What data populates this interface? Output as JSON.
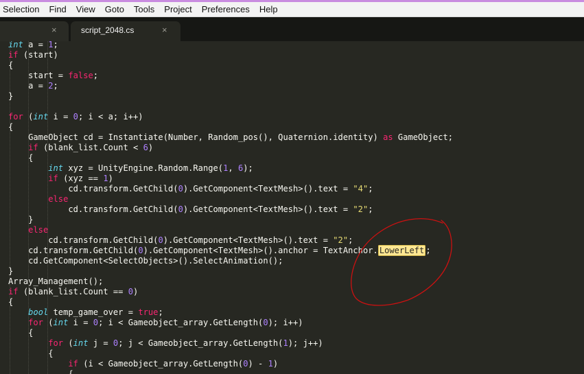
{
  "menu": [
    "Selection",
    "Find",
    "View",
    "Goto",
    "Tools",
    "Project",
    "Preferences",
    "Help"
  ],
  "tabs": [
    {
      "label": "",
      "close": "×"
    },
    {
      "label": "script_2048.cs",
      "close": "×"
    }
  ],
  "colors": {
    "keyword": "#f92672",
    "type": "#66d9ef",
    "number": "#ae81ff",
    "string": "#e6db74",
    "text": "#f8f8f2",
    "background": "#272822",
    "highlight": "#ffe792",
    "annotation": "#cc1111"
  },
  "code_lines": [
    [
      [
        "type",
        "int"
      ],
      [
        "t",
        " a = "
      ],
      [
        "num",
        "1"
      ],
      [
        "t",
        ";"
      ]
    ],
    [
      [
        "kw",
        "if"
      ],
      [
        "t",
        " (start)"
      ]
    ],
    [
      [
        "t",
        "{"
      ]
    ],
    [
      [
        "t",
        "    start = "
      ],
      [
        "kw",
        "false"
      ],
      [
        "t",
        ";"
      ]
    ],
    [
      [
        "t",
        "    a = "
      ],
      [
        "num",
        "2"
      ],
      [
        "t",
        ";"
      ]
    ],
    [
      [
        "t",
        "}"
      ]
    ],
    [],
    [
      [
        "kw",
        "for"
      ],
      [
        "t",
        " ("
      ],
      [
        "type",
        "int"
      ],
      [
        "t",
        " i = "
      ],
      [
        "num",
        "0"
      ],
      [
        "t",
        "; i < a; i++)"
      ]
    ],
    [
      [
        "t",
        "{"
      ]
    ],
    [
      [
        "t",
        "    GameObject cd = Instantiate(Number, Random_pos(), Quaternion.identity) "
      ],
      [
        "kw",
        "as"
      ],
      [
        "t",
        " GameObject;"
      ]
    ],
    [
      [
        "t",
        "    "
      ],
      [
        "kw",
        "if"
      ],
      [
        "t",
        " (blank_list.Count < "
      ],
      [
        "num",
        "6"
      ],
      [
        "t",
        ")"
      ]
    ],
    [
      [
        "t",
        "    {"
      ]
    ],
    [
      [
        "t",
        "        "
      ],
      [
        "type",
        "int"
      ],
      [
        "t",
        " xyz = UnityEngine.Random.Range("
      ],
      [
        "num",
        "1"
      ],
      [
        "t",
        ", "
      ],
      [
        "num",
        "6"
      ],
      [
        "t",
        ");"
      ]
    ],
    [
      [
        "t",
        "        "
      ],
      [
        "kw",
        "if"
      ],
      [
        "t",
        " (xyz == "
      ],
      [
        "num",
        "1"
      ],
      [
        "t",
        ")"
      ]
    ],
    [
      [
        "t",
        "            cd.transform.GetChild("
      ],
      [
        "num",
        "0"
      ],
      [
        "t",
        ").GetComponent<TextMesh>().text = "
      ],
      [
        "str",
        "\"4\""
      ],
      [
        "t",
        ";"
      ]
    ],
    [
      [
        "t",
        "        "
      ],
      [
        "kw",
        "else"
      ]
    ],
    [
      [
        "t",
        "            cd.transform.GetChild("
      ],
      [
        "num",
        "0"
      ],
      [
        "t",
        ").GetComponent<TextMesh>().text = "
      ],
      [
        "str",
        "\"2\""
      ],
      [
        "t",
        ";"
      ]
    ],
    [
      [
        "t",
        "    }"
      ]
    ],
    [
      [
        "t",
        "    "
      ],
      [
        "kw",
        "else"
      ]
    ],
    [
      [
        "t",
        "        cd.transform.GetChild("
      ],
      [
        "num",
        "0"
      ],
      [
        "t",
        ").GetComponent<TextMesh>().text = "
      ],
      [
        "str",
        "\"2\""
      ],
      [
        "t",
        ";"
      ]
    ],
    [
      [
        "t",
        "    cd.transform.GetChild("
      ],
      [
        "num",
        "0"
      ],
      [
        "t",
        ").GetComponent<TextMesh>().anchor = TextAnchor."
      ],
      [
        "hl",
        "LowerLeft"
      ],
      [
        "t",
        ";"
      ]
    ],
    [
      [
        "t",
        "    cd.GetComponent<SelectObjects>().SelectAnimation();"
      ]
    ],
    [
      [
        "t",
        "}"
      ]
    ],
    [
      [
        "t",
        "Array_Management();"
      ]
    ],
    [
      [
        "kw",
        "if"
      ],
      [
        "t",
        " (blank_list.Count == "
      ],
      [
        "num",
        "0"
      ],
      [
        "t",
        ")"
      ]
    ],
    [
      [
        "t",
        "{"
      ]
    ],
    [
      [
        "t",
        "    "
      ],
      [
        "type",
        "bool"
      ],
      [
        "t",
        " temp_game_over = "
      ],
      [
        "kw",
        "true"
      ],
      [
        "t",
        ";"
      ]
    ],
    [
      [
        "t",
        "    "
      ],
      [
        "kw",
        "for"
      ],
      [
        "t",
        " ("
      ],
      [
        "type",
        "int"
      ],
      [
        "t",
        " i = "
      ],
      [
        "num",
        "0"
      ],
      [
        "t",
        "; i < Gameobject_array.GetLength("
      ],
      [
        "num",
        "0"
      ],
      [
        "t",
        "); i++)"
      ]
    ],
    [
      [
        "t",
        "    {"
      ]
    ],
    [
      [
        "t",
        "        "
      ],
      [
        "kw",
        "for"
      ],
      [
        "t",
        " ("
      ],
      [
        "type",
        "int"
      ],
      [
        "t",
        " j = "
      ],
      [
        "num",
        "0"
      ],
      [
        "t",
        "; j < Gameobject_array.GetLength("
      ],
      [
        "num",
        "1"
      ],
      [
        "t",
        "); j++)"
      ]
    ],
    [
      [
        "t",
        "        {"
      ]
    ],
    [
      [
        "t",
        "            "
      ],
      [
        "kw",
        "if"
      ],
      [
        "t",
        " (i < Gameobject_array.GetLength("
      ],
      [
        "num",
        "0"
      ],
      [
        "t",
        ") - "
      ],
      [
        "num",
        "1"
      ],
      [
        "t",
        ")"
      ]
    ],
    [
      [
        "t",
        "            {"
      ]
    ]
  ]
}
